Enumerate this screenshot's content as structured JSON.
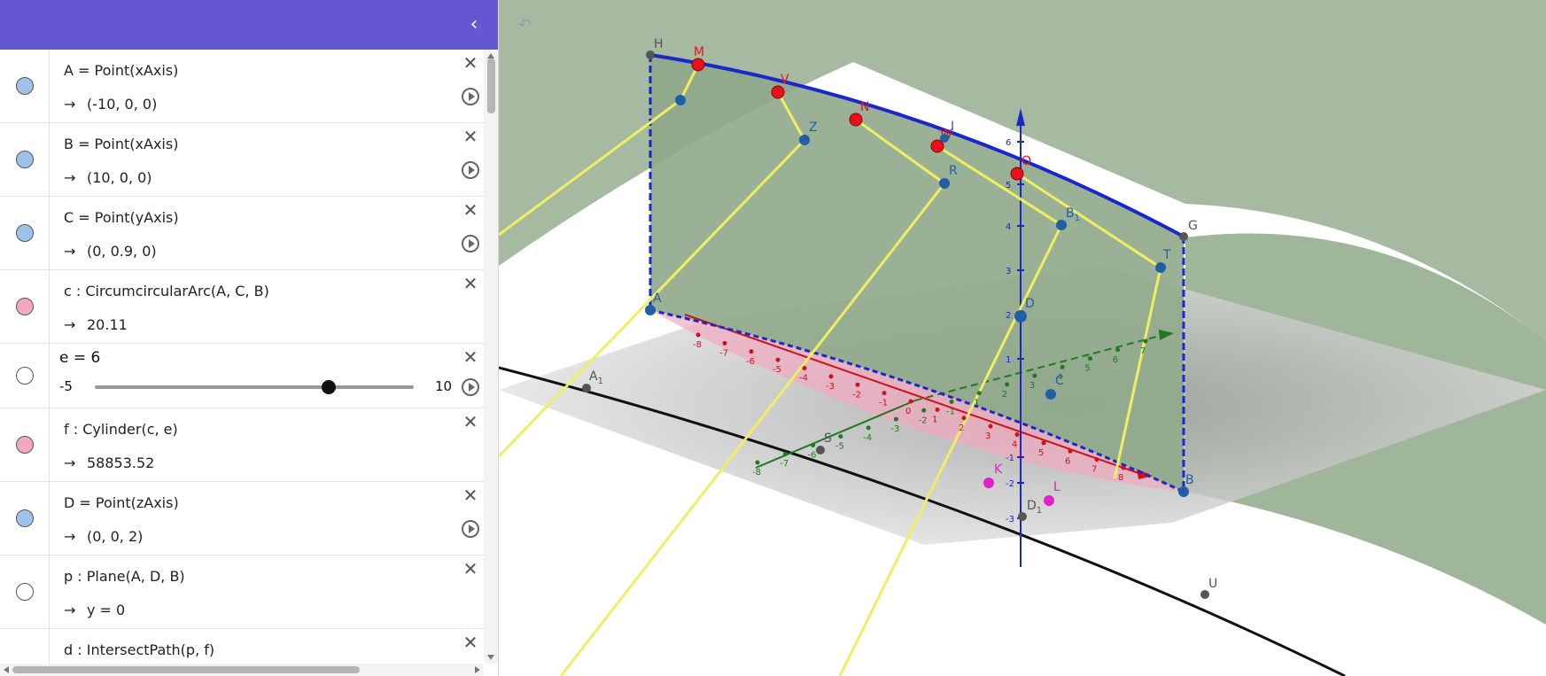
{
  "panel": {
    "collapse_icon": "chevron-left-icon",
    "rows": [
      {
        "def": "A = Point(xAxis)",
        "value": "(-10, 0, 0)",
        "color": "#9fc2ea",
        "has_play": true
      },
      {
        "def": "B = Point(xAxis)",
        "value": "(10, 0, 0)",
        "color": "#9fc2ea",
        "has_play": true
      },
      {
        "def": "C = Point(yAxis)",
        "value": "(0, 0.9, 0)",
        "color": "#9fc2ea",
        "has_play": true
      },
      {
        "def": "c : CircumcircularArc(A, C, B)",
        "value": "20.11",
        "color": "#f2a9c0",
        "has_play": false
      }
    ],
    "slider": {
      "label": "e = 6",
      "min": "-5",
      "max": "10",
      "value": 6,
      "min_value": -5,
      "max_value": 10,
      "color": "#ffffff"
    },
    "rows2": [
      {
        "def": "f : Cylinder(c, e)",
        "value": "58853.52",
        "color": "#f2a9c0",
        "has_play": false
      },
      {
        "def": "D = Point(zAxis)",
        "value": "(0, 0, 2)",
        "color": "#9fc2ea",
        "has_play": true
      },
      {
        "def": "p : Plane(A, D, B)",
        "value": "y = 0",
        "color": "#ffffff",
        "has_play": false
      },
      {
        "def": "d : IntersectPath(p, f)",
        "value": "",
        "color": "#ffffff",
        "has_play": false
      }
    ],
    "arrow": "→",
    "delete_glyph": "✕"
  },
  "graphics": {
    "undo_icon": "undo-icon",
    "points": {
      "H": "H",
      "M": "M",
      "V": "V",
      "N": "N",
      "W": "W",
      "I": "I",
      "O": "O",
      "G": "G",
      "Z": "Z",
      "R": "R",
      "B1": "B",
      "B1_sub": "1",
      "T": "T",
      "D": "D",
      "C": "C",
      "A": "A",
      "A1": "A",
      "A1_sub": "1",
      "S": "S",
      "K": "K",
      "L": "L",
      "D1": "D",
      "D1_sub": "1",
      "U": "U",
      "Bb": "B"
    },
    "x_ticks": [
      "-8",
      "-7",
      "-6",
      "-5",
      "-4",
      "-3",
      "-2",
      "-1",
      "0",
      "1",
      "2",
      "3",
      "4",
      "5",
      "6",
      "7",
      "8"
    ],
    "y_ticks": [
      "-8",
      "-7",
      "-6",
      "-5",
      "-4",
      "-3",
      "-2",
      "-1",
      "1",
      "2",
      "3",
      "4",
      "5",
      "6",
      "7"
    ],
    "z_ticks": [
      "-3",
      "-2",
      "-1",
      "1",
      "2",
      "3",
      "4",
      "5",
      "6"
    ],
    "colors": {
      "panel_header": "#6557d2",
      "surface": "#8fa98a",
      "arc_blue": "#1a27c9",
      "point_red": "#e8101a",
      "point_blue": "#1f5fa8",
      "point_magenta": "#e020c8",
      "ray_yellow": "#f0ee62",
      "x_axis": "#d0101a",
      "y_axis": "#1f7a1f",
      "z_axis": "#1a27c9"
    }
  }
}
